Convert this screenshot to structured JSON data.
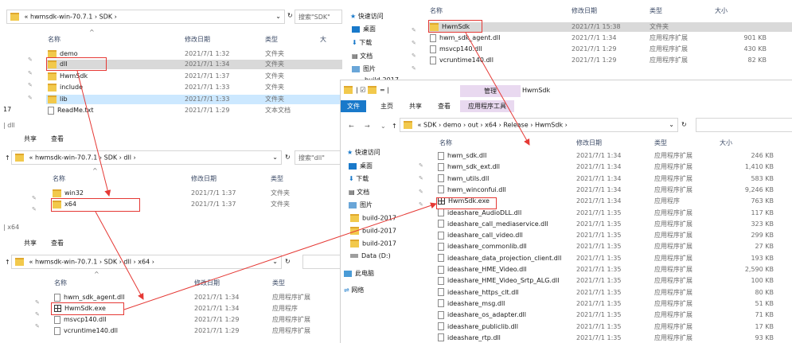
{
  "colors": {
    "accent": "#1979ca",
    "highlight": "#e53935",
    "arrow": "#e53935",
    "selected": "#cce8ff"
  },
  "panel1": {
    "crumbs": [
      "«",
      "hwmsdk-win-70.7.1",
      "›",
      "SDK",
      "›"
    ],
    "search_placeholder": "搜索\"SDK\"",
    "col_name": "名称",
    "col_date": "修改日期",
    "col_type": "类型",
    "col_size": "大",
    "left_num": "17",
    "rows": [
      {
        "name": "demo",
        "date": "2021/7/1 1:32",
        "type": "文件夹"
      },
      {
        "name": "dll",
        "date": "2021/7/1 1:34",
        "type": "文件夹"
      },
      {
        "name": "HwmSdk",
        "date": "2021/7/1 1:37",
        "type": "文件夹"
      },
      {
        "name": "include",
        "date": "2021/7/1 1:33",
        "type": "文件夹"
      },
      {
        "name": "lib",
        "date": "2021/7/1 1:33",
        "type": "文件夹"
      },
      {
        "name": "ReadMe.txt",
        "date": "2021/7/1 1:29",
        "type": "文本文档"
      }
    ]
  },
  "panel2": {
    "title": "dll",
    "tabs": [
      "共享",
      "查看"
    ],
    "crumbs": [
      "«",
      "hwmsdk-win-70.7.1",
      "›",
      "SDK",
      "›",
      "dll",
      "›"
    ],
    "search_placeholder": "搜索\"dll\"",
    "col_name": "名称",
    "col_date": "修改日期",
    "col_type": "类型",
    "rows": [
      {
        "name": "win32",
        "date": "2021/7/1 1:37",
        "type": "文件夹"
      },
      {
        "name": "x64",
        "date": "2021/7/1 1:37",
        "type": "文件夹"
      }
    ]
  },
  "panel3": {
    "title": "x64",
    "tabs": [
      "共享",
      "查看"
    ],
    "crumbs": [
      "«",
      "hwmsdk-win-70.7.1",
      "›",
      "SDK",
      "›",
      "dll",
      "›",
      "x64",
      "›"
    ],
    "col_name": "名称",
    "col_date": "修改日期",
    "col_type": "类型",
    "rows": [
      {
        "name": "hwm_sdk_agent.dll",
        "date": "2021/7/1 1:34",
        "type": "应用程序扩展"
      },
      {
        "name": "HwmSdk.exe",
        "date": "2021/7/1 1:34",
        "type": "应用程序"
      },
      {
        "name": "msvcp140.dll",
        "date": "2021/7/1 1:29",
        "type": "应用程序扩展"
      },
      {
        "name": "vcruntime140.dll",
        "date": "2021/7/1 1:29",
        "type": "应用程序扩展"
      }
    ]
  },
  "panel4": {
    "nav": [
      "快速访问",
      "桌面",
      "下载",
      "文档",
      "图片",
      "build-2017"
    ],
    "col_name": "名称",
    "col_date": "修改日期",
    "col_type": "类型",
    "col_size": "大小",
    "rows": [
      {
        "name": "HwmSdk",
        "date": "2021/7/1 15:38",
        "type": "文件夹",
        "size": ""
      },
      {
        "name": "hwm_sdk_agent.dll",
        "date": "2021/7/1 1:34",
        "type": "应用程序扩展",
        "size": "901 KB"
      },
      {
        "name": "msvcp140.dll",
        "date": "2021/7/1 1:29",
        "type": "应用程序扩展",
        "size": "430 KB"
      },
      {
        "name": "vcruntime140.dll",
        "date": "2021/7/1 1:29",
        "type": "应用程序扩展",
        "size": "82 KB"
      }
    ]
  },
  "panel5": {
    "manage": "管理",
    "app": "HwmSdk",
    "tabs": [
      "文件",
      "主页",
      "共享",
      "查看",
      "应用程序工具"
    ],
    "crumbs": [
      "«",
      "SDK",
      "›",
      "demo",
      "›",
      "out",
      "›",
      "x64",
      "›",
      "Release",
      "›",
      "HwmSdk",
      "›"
    ],
    "nav": [
      "快速访问",
      "桌面",
      "下载",
      "文档",
      "图片",
      "build-2017",
      "build-2017",
      "build-2017",
      "Data (D:)",
      "此电脑",
      "网络"
    ],
    "col_name": "名称",
    "col_date": "修改日期",
    "col_type": "类型",
    "col_size": "大小",
    "rows": [
      {
        "name": "hwm_sdk.dll",
        "date": "2021/7/1 1:34",
        "type": "应用程序扩展",
        "size": "246 KB"
      },
      {
        "name": "hwm_sdk_ext.dll",
        "date": "2021/7/1 1:34",
        "type": "应用程序扩展",
        "size": "1,410 KB"
      },
      {
        "name": "hwm_utils.dll",
        "date": "2021/7/1 1:34",
        "type": "应用程序扩展",
        "size": "583 KB"
      },
      {
        "name": "hwm_winconfui.dll",
        "date": "2021/7/1 1:34",
        "type": "应用程序扩展",
        "size": "9,246 KB"
      },
      {
        "name": "HwmSdk.exe",
        "date": "2021/7/1 1:34",
        "type": "应用程序",
        "size": "763 KB"
      },
      {
        "name": "ideashare_AudioDLL.dll",
        "date": "2021/7/1 1:35",
        "type": "应用程序扩展",
        "size": "117 KB"
      },
      {
        "name": "ideashare_call_mediaservice.dll",
        "date": "2021/7/1 1:35",
        "type": "应用程序扩展",
        "size": "323 KB"
      },
      {
        "name": "ideashare_call_video.dll",
        "date": "2021/7/1 1:35",
        "type": "应用程序扩展",
        "size": "299 KB"
      },
      {
        "name": "ideashare_commonlib.dll",
        "date": "2021/7/1 1:35",
        "type": "应用程序扩展",
        "size": "27 KB"
      },
      {
        "name": "ideashare_data_projection_client.dll",
        "date": "2021/7/1 1:35",
        "type": "应用程序扩展",
        "size": "193 KB"
      },
      {
        "name": "ideashare_HME_Video.dll",
        "date": "2021/7/1 1:35",
        "type": "应用程序扩展",
        "size": "2,590 KB"
      },
      {
        "name": "ideashare_HME_Video_Srtp_ALG.dll",
        "date": "2021/7/1 1:35",
        "type": "应用程序扩展",
        "size": "100 KB"
      },
      {
        "name": "ideashare_https_clt.dll",
        "date": "2021/7/1 1:35",
        "type": "应用程序扩展",
        "size": "80 KB"
      },
      {
        "name": "ideashare_msg.dll",
        "date": "2021/7/1 1:35",
        "type": "应用程序扩展",
        "size": "51 KB"
      },
      {
        "name": "ideashare_os_adapter.dll",
        "date": "2021/7/1 1:35",
        "type": "应用程序扩展",
        "size": "71 KB"
      },
      {
        "name": "ideashare_publiclib.dll",
        "date": "2021/7/1 1:35",
        "type": "应用程序扩展",
        "size": "17 KB"
      },
      {
        "name": "ideashare_rtp.dll",
        "date": "2021/7/1 1:35",
        "type": "应用程序扩展",
        "size": "93 KB"
      }
    ]
  }
}
